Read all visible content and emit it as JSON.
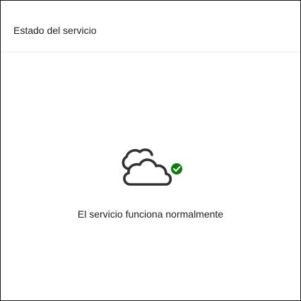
{
  "card": {
    "title": "Estado del servicio"
  },
  "status": {
    "message": "El servicio funciona normalmente",
    "icon": "cloud-icon",
    "badge_icon": "check-circle-icon",
    "state": "healthy"
  },
  "colors": {
    "success": "#107c10",
    "icon_stroke": "#323130",
    "text": "#201f1e",
    "divider": "#edebe9",
    "border": "#1a1a1a"
  }
}
